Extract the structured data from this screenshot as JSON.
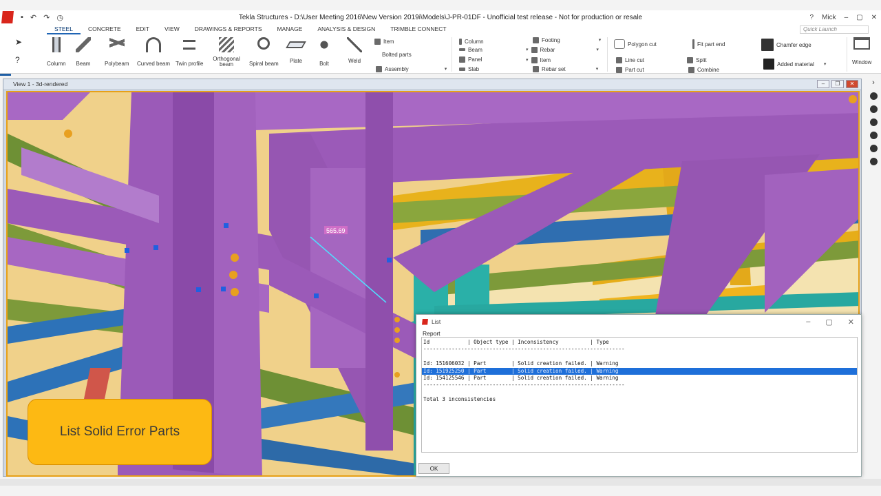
{
  "app": {
    "title": "Tekla Structures - D:\\User Meeting 2016\\New Version 2019i\\Models\\J-PR-01DF - Unofficial test release - Not for production or resale",
    "user": "Mick",
    "help_glyph": "?",
    "window_controls": {
      "minimize": "–",
      "maximize": "▢",
      "close": "✕"
    },
    "quick_access": {
      "save": "▪",
      "undo": "↶",
      "redo": "↷",
      "history": "◷"
    }
  },
  "menu": {
    "tabs": [
      {
        "label": "STEEL",
        "active": true
      },
      {
        "label": "CONCRETE",
        "active": false
      },
      {
        "label": "EDIT",
        "active": false
      },
      {
        "label": "VIEW",
        "active": false
      },
      {
        "label": "DRAWINGS & REPORTS",
        "active": false
      },
      {
        "label": "MANAGE",
        "active": false
      },
      {
        "label": "ANALYSIS & DESIGN",
        "active": false
      },
      {
        "label": "TRIMBLE CONNECT",
        "active": false
      }
    ],
    "quick_launch_placeholder": "Quick Launch"
  },
  "ribbon": {
    "left_tools": {
      "select": "➤",
      "help": "?"
    },
    "buttons": [
      {
        "label": "Column",
        "icon": "column-icon"
      },
      {
        "label": "Beam",
        "icon": "beam-icon"
      },
      {
        "label": "Polybeam",
        "icon": "polybeam-icon"
      },
      {
        "label": "Curved beam",
        "icon": "curved-beam-icon"
      },
      {
        "label": "Twin profile",
        "icon": "twin-profile-icon"
      },
      {
        "label": "Orthogonal beam",
        "icon": "orthogonal-beam-icon"
      },
      {
        "label": "Spiral beam",
        "icon": "spiral-beam-icon"
      },
      {
        "label": "Plate",
        "icon": "plate-icon"
      },
      {
        "label": "Bolt",
        "icon": "bolt-icon"
      },
      {
        "label": "Weld",
        "icon": "weld-icon"
      }
    ],
    "small_group1": [
      "Item",
      "Bolted parts",
      "Assembly"
    ],
    "small_group2": [
      "Column",
      "Beam",
      "Panel",
      "Slab"
    ],
    "small_group3": [
      "Footing",
      "Rebar",
      "Item",
      "Rebar set"
    ],
    "small_group4": [
      "Polygon cut",
      "Line cut",
      "Part cut"
    ],
    "small_group5": [
      "Fit part end",
      "Split",
      "Combine"
    ],
    "small_group6": [
      "Chamfer edge",
      "Added material"
    ],
    "window_label": "Window",
    "dropdown_glyph": "▾"
  },
  "view": {
    "title": "View 1 - 3d-rendered",
    "dimension_label": "565.69",
    "controls": {
      "minimize": "–",
      "restore": "❐",
      "close": "✕"
    }
  },
  "dialog": {
    "title": "List",
    "section": "Report",
    "controls": {
      "minimize": "–",
      "maximize": "▢",
      "close": "✕"
    },
    "header_line": "Id            | Object type | Inconsistency          | Type",
    "separator": "----------------------------------------------------------------",
    "rows": [
      {
        "text": "Id: 151606032 | Part        | Solid creation failed. | Warning",
        "selected": false
      },
      {
        "text": "Id: 151925250 | Part        | Solid creation failed. | Warning",
        "selected": true
      },
      {
        "text": "Id: 154125546 | Part        | Solid creation failed. | Warning",
        "selected": false
      }
    ],
    "total": "Total 3 inconsistencies",
    "ok_label": "OK"
  },
  "caption": {
    "text": "List Solid Error Parts"
  },
  "colors": {
    "accent": "#1f65b5",
    "selection": "#1e6fd9",
    "caption_bg": "#fdb913",
    "purple_steel": "#9b5ab8",
    "green_steel": "#7d9a3a",
    "teal_steel": "#2ab0a8",
    "yellow_steel": "#f0b21c",
    "blue_steel": "#2d72b8"
  }
}
